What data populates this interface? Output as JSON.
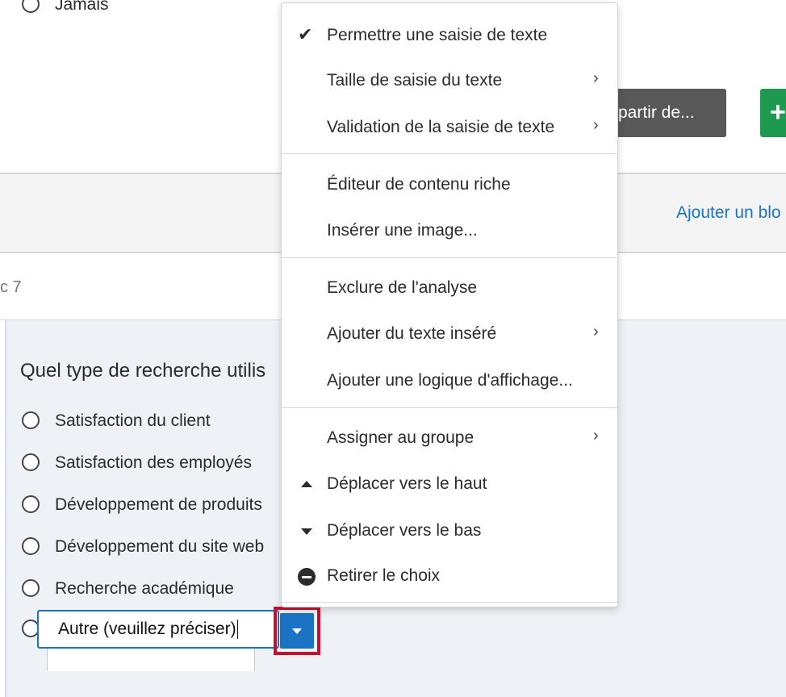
{
  "top": {
    "option_partial_label": "Jamais",
    "copy_button_label": "partir de...",
    "add_button_label": "+"
  },
  "band": {
    "add_block_link": "Ajouter un blo"
  },
  "block": {
    "name_partial": "c 7"
  },
  "question": {
    "text": "Quel type de recherche utilis",
    "choices": [
      "Satisfaction du client",
      "Satisfaction des employés",
      "Développement de produits",
      "Développement du site web",
      "Recherche académique"
    ],
    "other_value": "Autre (veuillez préciser)"
  },
  "menu": {
    "items": [
      {
        "label": "Permettre une saisie de texte",
        "lead_icon": "check-icon",
        "submenu": false
      },
      {
        "label": "Taille de saisie du texte",
        "submenu": true
      },
      {
        "label": "Validation de la saisie de texte",
        "submenu": true
      },
      {
        "label": "Éditeur de contenu riche",
        "submenu": false
      },
      {
        "label": "Insérer une image...",
        "submenu": false
      },
      {
        "label": "Exclure de l'analyse",
        "submenu": false
      },
      {
        "label": "Ajouter du texte inséré",
        "submenu": true
      },
      {
        "label": "Ajouter une logique d'affichage...",
        "submenu": false
      },
      {
        "label": "Assigner au groupe",
        "submenu": true
      },
      {
        "label": "Déplacer vers le haut",
        "lead_icon": "triangle-up-icon",
        "submenu": false
      },
      {
        "label": "Déplacer vers le bas",
        "lead_icon": "triangle-down-icon",
        "submenu": false
      },
      {
        "label": "Retirer le choix",
        "lead_icon": "minus-circle-icon",
        "submenu": false
      }
    ],
    "check_glyph": "✔",
    "chevron_glyph": "›"
  },
  "colors": {
    "link_blue": "#1b73c4",
    "highlight_red": "#c8102e",
    "add_green": "#1e9a50",
    "button_gray": "#585858"
  }
}
